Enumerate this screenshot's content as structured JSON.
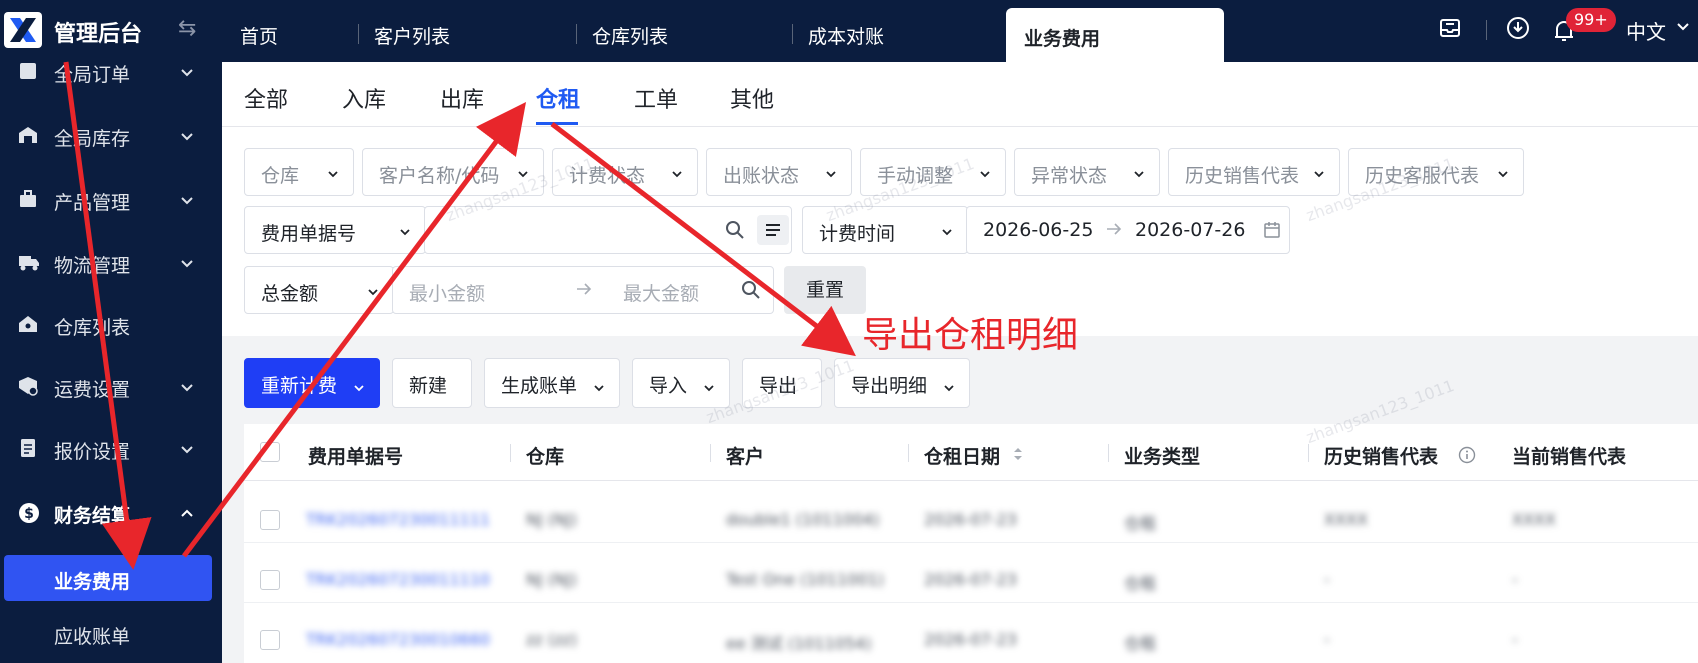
{
  "app": {
    "brand": "管理后台",
    "logo_icon": "x-logo-icon"
  },
  "header": {
    "tabs": [
      {
        "label": "首页"
      },
      {
        "label": "客户列表"
      },
      {
        "label": "仓库列表"
      },
      {
        "label": "成本对账"
      },
      {
        "label": "业务费用"
      }
    ],
    "active_tab": "业务费用",
    "notification_badge": "99+",
    "language": "中文"
  },
  "sidebar": {
    "items": [
      {
        "label": "全局订单",
        "icon": "order-icon"
      },
      {
        "label": "全局库存",
        "icon": "warehouse-icon"
      },
      {
        "label": "产品管理",
        "icon": "box-icon"
      },
      {
        "label": "物流管理",
        "icon": "truck-icon"
      },
      {
        "label": "仓库列表",
        "icon": "house-icon"
      },
      {
        "label": "运费设置",
        "icon": "shipping-icon"
      },
      {
        "label": "报价设置",
        "icon": "document-icon"
      },
      {
        "label": "财务结算",
        "icon": "dollar-icon"
      }
    ],
    "sub_items": [
      {
        "label": "业务费用",
        "active": true
      },
      {
        "label": "应收账单",
        "active": false
      }
    ]
  },
  "subtabs": [
    "全部",
    "入库",
    "出库",
    "仓租",
    "工单",
    "其他"
  ],
  "active_subtab": "仓租",
  "filters": {
    "row1": [
      "仓库",
      "客户名称/代码",
      "计费状态",
      "出账状态",
      "手动调整",
      "异常状态",
      "历史销售代表",
      "历史客服代表"
    ],
    "doc_no_select": "费用单据号",
    "billing_time_select": "计费时间",
    "date_start": "2026-06-25",
    "date_end": "2026-07-26",
    "amount_select": "总金额",
    "min_amount_placeholder": "最小金额",
    "max_amount_placeholder": "最大金额",
    "reset_label": "重置"
  },
  "toolbar": {
    "recalculate": "重新计费",
    "create": "新建",
    "generate_bill": "生成账单",
    "import": "导入",
    "export": "导出",
    "export_detail": "导出明细"
  },
  "table": {
    "columns": [
      "费用单据号",
      "仓库",
      "客户",
      "仓租日期",
      "业务类型",
      "历史销售代表",
      "当前销售代表"
    ],
    "rows": [
      [
        "TRK202607230011111",
        "NJ (NJ)",
        "double1 (1011004)",
        "2026-07-23",
        "仓租",
        "XXXX",
        "XXXX"
      ],
      [
        "TRK202607230011110",
        "NJ (NJ)",
        "Test One (1011001)",
        "2026-07-23",
        "仓租",
        "-",
        "-"
      ],
      [
        "TRK202607230010660",
        "zz (zz)",
        "ee 测试 (1011054)",
        "2026-07-23",
        "仓租",
        "-",
        "-"
      ]
    ]
  },
  "annotation": {
    "text": "导出仓租明细",
    "color": "#e8262b"
  },
  "watermark": "zhangsan123_1011"
}
